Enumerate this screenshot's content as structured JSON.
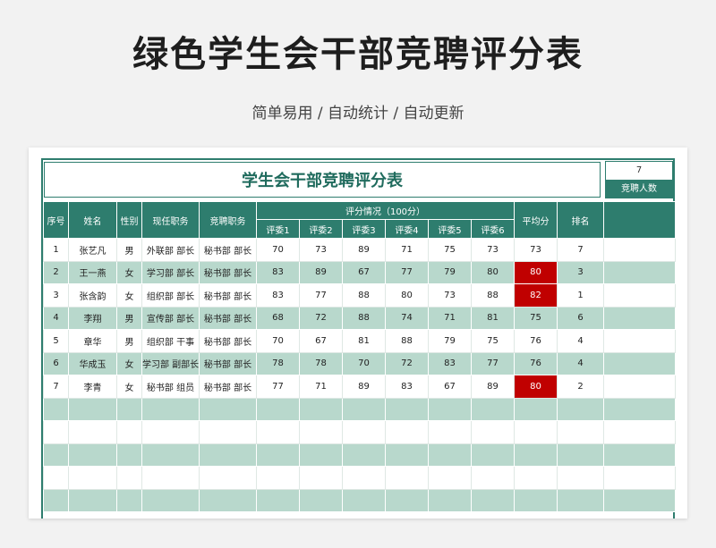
{
  "page": {
    "title": "绿色学生会干部竞聘评分表",
    "subtitle": "简单易用 / 自动统计 / 自动更新"
  },
  "sheet": {
    "title": "学生会干部竞聘评分表",
    "count_value": "7",
    "count_label": "竞聘人数",
    "highlight_color": "#c00000",
    "header_color": "#2e7d6e",
    "stripe_color": "#b8d8cc"
  },
  "headers": {
    "no": "序号",
    "name": "姓名",
    "gender": "性别",
    "current": "现任职务",
    "target": "竞聘职务",
    "score_group": "评分情况（100分）",
    "judges": [
      "评委1",
      "评委2",
      "评委3",
      "评委4",
      "评委5",
      "评委6"
    ],
    "avg": "平均分",
    "rank": "排名"
  },
  "rows": [
    {
      "no": "1",
      "name": "张艺凡",
      "gender": "男",
      "current": "外联部 部长",
      "target": "秘书部 部长",
      "scores": [
        "70",
        "73",
        "89",
        "71",
        "75",
        "73"
      ],
      "avg": "73",
      "rank": "7",
      "highlight": false
    },
    {
      "no": "2",
      "name": "王一燕",
      "gender": "女",
      "current": "学习部 部长",
      "target": "秘书部 部长",
      "scores": [
        "83",
        "89",
        "67",
        "77",
        "79",
        "80"
      ],
      "avg": "80",
      "rank": "3",
      "highlight": true
    },
    {
      "no": "3",
      "name": "张含韵",
      "gender": "女",
      "current": "组织部 部长",
      "target": "秘书部 部长",
      "scores": [
        "83",
        "77",
        "88",
        "80",
        "73",
        "88"
      ],
      "avg": "82",
      "rank": "1",
      "highlight": true
    },
    {
      "no": "4",
      "name": "李翔",
      "gender": "男",
      "current": "宣传部 部长",
      "target": "秘书部 部长",
      "scores": [
        "68",
        "72",
        "88",
        "74",
        "71",
        "81"
      ],
      "avg": "75",
      "rank": "6",
      "highlight": false
    },
    {
      "no": "5",
      "name": "章华",
      "gender": "男",
      "current": "组织部 干事",
      "target": "秘书部 部长",
      "scores": [
        "70",
        "67",
        "81",
        "88",
        "79",
        "75"
      ],
      "avg": "76",
      "rank": "4",
      "highlight": false
    },
    {
      "no": "6",
      "name": "华成玉",
      "gender": "女",
      "current": "学习部 副部长",
      "target": "秘书部 部长",
      "scores": [
        "78",
        "78",
        "70",
        "72",
        "83",
        "77"
      ],
      "avg": "76",
      "rank": "4",
      "highlight": false
    },
    {
      "no": "7",
      "name": "李青",
      "gender": "女",
      "current": "秘书部 组员",
      "target": "秘书部 部长",
      "scores": [
        "77",
        "71",
        "89",
        "83",
        "67",
        "89"
      ],
      "avg": "80",
      "rank": "2",
      "highlight": true
    },
    {
      "no": "",
      "name": "",
      "gender": "",
      "current": "",
      "target": "",
      "scores": [
        "",
        "",
        "",
        "",
        "",
        ""
      ],
      "avg": "",
      "rank": "",
      "highlight": false
    },
    {
      "no": "",
      "name": "",
      "gender": "",
      "current": "",
      "target": "",
      "scores": [
        "",
        "",
        "",
        "",
        "",
        ""
      ],
      "avg": "",
      "rank": "",
      "highlight": false
    },
    {
      "no": "",
      "name": "",
      "gender": "",
      "current": "",
      "target": "",
      "scores": [
        "",
        "",
        "",
        "",
        "",
        ""
      ],
      "avg": "",
      "rank": "",
      "highlight": false
    },
    {
      "no": "",
      "name": "",
      "gender": "",
      "current": "",
      "target": "",
      "scores": [
        "",
        "",
        "",
        "",
        "",
        ""
      ],
      "avg": "",
      "rank": "",
      "highlight": false
    },
    {
      "no": "",
      "name": "",
      "gender": "",
      "current": "",
      "target": "",
      "scores": [
        "",
        "",
        "",
        "",
        "",
        ""
      ],
      "avg": "",
      "rank": "",
      "highlight": false
    }
  ]
}
